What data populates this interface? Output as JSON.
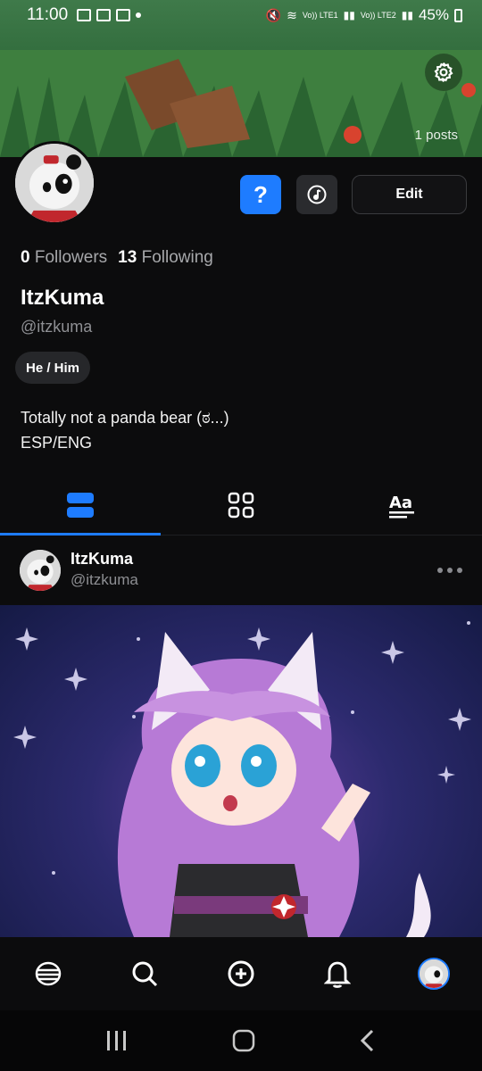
{
  "status_bar": {
    "time": "11:00",
    "battery": "45%",
    "network_1": "Vo)) LTE1",
    "network_2": "Vo)) LTE2"
  },
  "banner": {
    "posts_count": "1 posts",
    "settings_icon": "gear-icon"
  },
  "profile": {
    "help_button": "?",
    "music_icon": "music-note-icon",
    "edit_label": "Edit",
    "followers_count": "0",
    "followers_label": "Followers",
    "following_count": "13",
    "following_label": "Following",
    "name": "ItzKuma",
    "handle": "@itzkuma",
    "pronouns": "He / Him",
    "bio_line1": "Totally not a panda bear (ಠ...)",
    "bio_line2": "ESP/ENG"
  },
  "tabs": [
    {
      "icon": "list-view-icon",
      "active": true
    },
    {
      "icon": "grid-view-icon",
      "active": false
    },
    {
      "icon": "text-view-icon",
      "active": false
    }
  ],
  "post": {
    "author_name": "ItzKuma",
    "author_handle": "@itzkuma",
    "more_icon": "more-dots-icon"
  },
  "bottom_nav": [
    {
      "icon": "home-icon"
    },
    {
      "icon": "search-icon"
    },
    {
      "icon": "create-icon"
    },
    {
      "icon": "bell-icon"
    },
    {
      "icon": "profile-avatar"
    }
  ],
  "colors": {
    "accent": "#1e7cff",
    "background": "#0c0c0d",
    "muted_text": "#8e8f93"
  }
}
